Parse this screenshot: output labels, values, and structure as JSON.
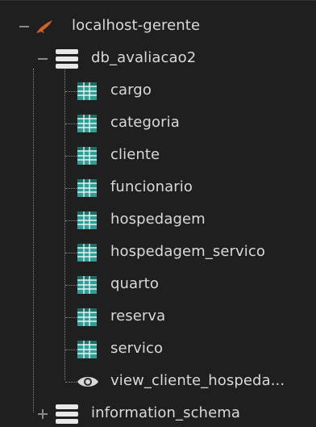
{
  "server": {
    "label": "localhost-gerente",
    "expander": "collapse-minus",
    "icon": "dolphin-icon"
  },
  "database": {
    "label": "db_avaliacao2",
    "expander": "collapse-minus",
    "icon": "database-icon"
  },
  "tables": [
    {
      "label": "cargo"
    },
    {
      "label": "categoria"
    },
    {
      "label": "cliente"
    },
    {
      "label": "funcionario"
    },
    {
      "label": "hospedagem"
    },
    {
      "label": "hospedagem_servico"
    },
    {
      "label": "quarto"
    },
    {
      "label": "reserva"
    },
    {
      "label": "servico"
    }
  ],
  "view": {
    "label": "view_cliente_hospeda...",
    "icon": "eye-icon"
  },
  "database2": {
    "label": "information_schema",
    "expander": "expand-plus",
    "icon": "database-icon"
  },
  "colors": {
    "background": "#1f1f1f",
    "text": "#d9d9d9",
    "table_icon": "#2e9e96",
    "dolphin": "#d0602a",
    "db_icon": "#e8e8e8"
  }
}
